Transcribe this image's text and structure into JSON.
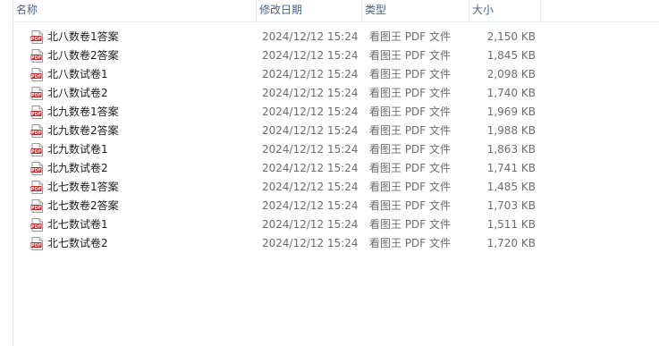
{
  "columns": {
    "name": "名称",
    "date": "修改日期",
    "type": "类型",
    "size": "大小"
  },
  "files": [
    {
      "name": "北八数卷1答案",
      "date": "2024/12/12 15:24",
      "type": "看图王 PDF 文件",
      "size": "2,150 KB"
    },
    {
      "name": "北八数卷2答案",
      "date": "2024/12/12 15:24",
      "type": "看图王 PDF 文件",
      "size": "1,845 KB"
    },
    {
      "name": "北八数试卷1",
      "date": "2024/12/12 15:24",
      "type": "看图王 PDF 文件",
      "size": "2,098 KB"
    },
    {
      "name": "北八数试卷2",
      "date": "2024/12/12 15:24",
      "type": "看图王 PDF 文件",
      "size": "1,740 KB"
    },
    {
      "name": "北九数卷1答案",
      "date": "2024/12/12 15:24",
      "type": "看图王 PDF 文件",
      "size": "1,969 KB"
    },
    {
      "name": "北九数卷2答案",
      "date": "2024/12/12 15:24",
      "type": "看图王 PDF 文件",
      "size": "1,988 KB"
    },
    {
      "name": "北九数试卷1",
      "date": "2024/12/12 15:24",
      "type": "看图王 PDF 文件",
      "size": "1,863 KB"
    },
    {
      "name": "北九数试卷2",
      "date": "2024/12/12 15:24",
      "type": "看图王 PDF 文件",
      "size": "1,741 KB"
    },
    {
      "name": "北七数卷1答案",
      "date": "2024/12/12 15:24",
      "type": "看图王 PDF 文件",
      "size": "1,485 KB"
    },
    {
      "name": "北七数卷2答案",
      "date": "2024/12/12 15:24",
      "type": "看图王 PDF 文件",
      "size": "1,703 KB"
    },
    {
      "name": "北七数试卷1",
      "date": "2024/12/12 15:24",
      "type": "看图王 PDF 文件",
      "size": "1,511 KB"
    },
    {
      "name": "北七数试卷2",
      "date": "2024/12/12 15:24",
      "type": "看图王 PDF 文件",
      "size": "1,720 KB"
    }
  ],
  "icons": {
    "file": "pdf-file-icon",
    "sort": "sort-caret-icon"
  },
  "colors": {
    "header_text": "#4d6185",
    "pdf_red": "#c0252b",
    "meta_text": "#6d6d6d"
  }
}
